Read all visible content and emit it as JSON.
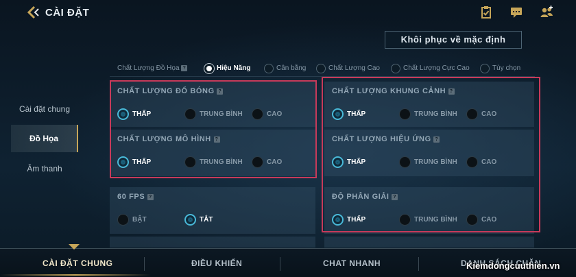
{
  "header": {
    "title": "CÀI ĐẶT",
    "icons": [
      "clipboard-check-icon",
      "chat-icon",
      "friends-icon"
    ]
  },
  "reset_button": "Khôi phục về mặc định",
  "sidebar": {
    "items": [
      {
        "label": "Cài đặt chung",
        "active": false
      },
      {
        "label": "Đồ Họa",
        "active": true
      },
      {
        "label": "Âm thanh",
        "active": false
      }
    ]
  },
  "presets": {
    "label": "Chất Lượng Đồ Họa",
    "options": [
      {
        "label": "Hiệu Năng",
        "selected": true
      },
      {
        "label": "Cân bằng",
        "selected": false
      },
      {
        "label": "Chất Lượng Cao",
        "selected": false
      },
      {
        "label": "Chất Lượng Cực Cao",
        "selected": false
      },
      {
        "label": "Tùy chọn",
        "selected": false
      }
    ]
  },
  "settings": {
    "shadow": {
      "title": "CHẤT LƯỢNG ĐỔ BÓNG",
      "options": [
        "THẤP",
        "TRUNG BÌNH",
        "CAO"
      ],
      "selected": "THẤP"
    },
    "model": {
      "title": "CHẤT LƯỢNG MÔ HÌNH",
      "options": [
        "THẤP",
        "TRUNG BÌNH",
        "CAO"
      ],
      "selected": "THẤP"
    },
    "fps": {
      "title": "60 FPS",
      "options": [
        "BẬT",
        "TẮT"
      ],
      "selected": "TẮT"
    },
    "scenery": {
      "title": "CHẤT LƯỢNG KHUNG CẢNH",
      "options": [
        "THẤP",
        "TRUNG BÌNH",
        "CAO"
      ],
      "selected": "THẤP"
    },
    "effects": {
      "title": "CHẤT LƯỢNG HIỆU ỨNG",
      "options": [
        "THẤP",
        "TRUNG BÌNH",
        "CAO"
      ],
      "selected": "THẤP"
    },
    "resolution": {
      "title": "ĐỘ PHÂN GIẢI",
      "options": [
        "THẤP",
        "TRUNG BÌNH",
        "CAO"
      ],
      "selected": "THẤP"
    }
  },
  "bottom_tabs": [
    {
      "label": "CÀI ĐẶT CHUNG",
      "active": true
    },
    {
      "label": "ĐIỀU KHIỂN",
      "active": false
    },
    {
      "label": "CHAT NHANH",
      "active": false
    },
    {
      "label": "DANH SÁCH CHẶN",
      "active": false
    }
  ],
  "watermark": "Kiemdongcuuthien.vn",
  "colors": {
    "accent_gold": "#c7a659",
    "selected_radio": "#49b9d8",
    "highlight_box": "#c83a5a"
  }
}
